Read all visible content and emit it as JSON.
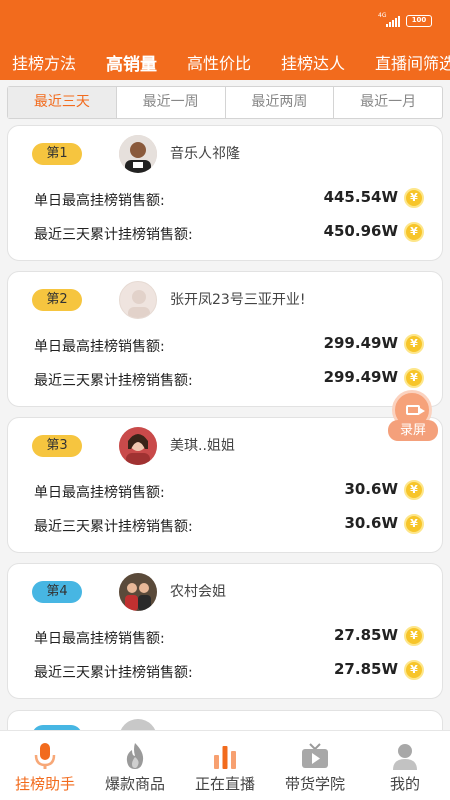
{
  "status_bar": {
    "network": "4G",
    "battery": "100"
  },
  "tabs": [
    {
      "label": "挂榜方法"
    },
    {
      "label": "高销量"
    },
    {
      "label": "高性价比"
    },
    {
      "label": "挂榜达人"
    },
    {
      "label": "直播间筛选"
    }
  ],
  "active_tab": "高销量",
  "periods": [
    {
      "label": "最近三天"
    },
    {
      "label": "最近一周"
    },
    {
      "label": "最近两周"
    },
    {
      "label": "最近一月"
    }
  ],
  "active_period": "最近三天",
  "ranking": [
    {
      "rank": "第1",
      "name": "音乐人祁隆",
      "label1": "单日最高挂榜销售额:",
      "value1": "445.54W",
      "label2": "最近三天累计挂榜销售额:",
      "value2": "450.96W"
    },
    {
      "rank": "第2",
      "name": "张开凤23号三亚开业!",
      "label1": "单日最高挂榜销售额:",
      "value1": "299.49W",
      "label2": "最近三天累计挂榜销售额:",
      "value2": "299.49W"
    },
    {
      "rank": "第3",
      "name": "美琪..姐姐",
      "label1": "单日最高挂榜销售额:",
      "value1": "30.6W",
      "label2": "最近三天累计挂榜销售额:",
      "value2": "30.6W"
    },
    {
      "rank": "第4",
      "name": "农村会姐",
      "label1": "单日最高挂榜销售额:",
      "value1": "27.85W",
      "label2": "最近三天累计挂榜销售额:",
      "value2": "27.85W"
    }
  ],
  "coin_symbol": "¥",
  "record_button": {
    "label": "录屏"
  },
  "bottom_nav": [
    {
      "label": "挂榜助手",
      "icon": "microphone-icon"
    },
    {
      "label": "爆款商品",
      "icon": "flame-icon"
    },
    {
      "label": "正在直播",
      "icon": "bar-chart-icon"
    },
    {
      "label": "带货学院",
      "icon": "tv-play-icon"
    },
    {
      "label": "我的",
      "icon": "person-icon"
    }
  ],
  "colors": {
    "accent": "#f26b1d",
    "gold_badge": "#f6c53f",
    "blue_badge": "#47b6e3",
    "coin": "#f7c52a"
  }
}
